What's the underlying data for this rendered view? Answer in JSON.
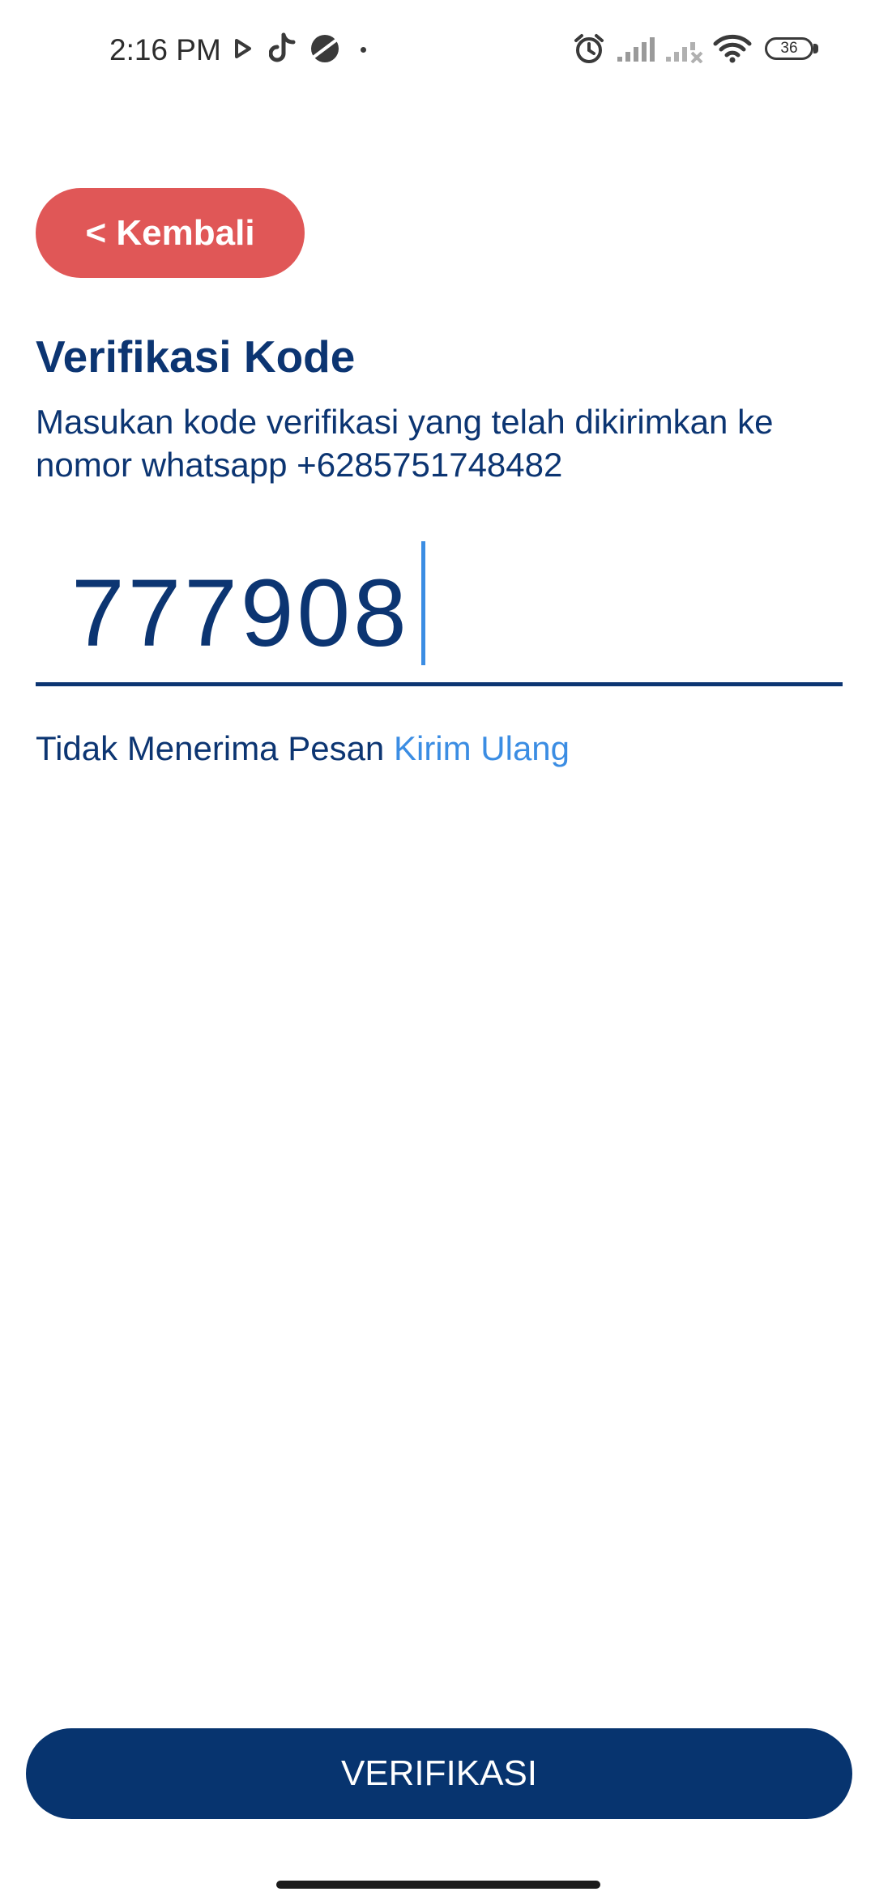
{
  "status_bar": {
    "time": "2:16 PM",
    "battery": "36",
    "icons": [
      "play-icon",
      "tiktok-icon",
      "planet-icon",
      "dot-icon",
      "alarm-icon",
      "signal-icon",
      "signal-no-service-icon",
      "wifi-icon",
      "battery-icon"
    ]
  },
  "header": {
    "back_label": "< Kembali"
  },
  "main": {
    "title": "Verifikasi Kode",
    "subtitle": "Masukan kode verifikasi yang telah dikirimkan ke nomor whatsapp +6285751748482",
    "code_value": "777908",
    "resend_text": "Tidak Menerima Pesan",
    "resend_link": "Kirim Ulang"
  },
  "footer": {
    "verify_label": "VERIFIKASI"
  },
  "colors": {
    "primary": "#0c3572",
    "back_button": "#e05757",
    "link": "#3b8de3",
    "verify_button": "#07346f"
  }
}
